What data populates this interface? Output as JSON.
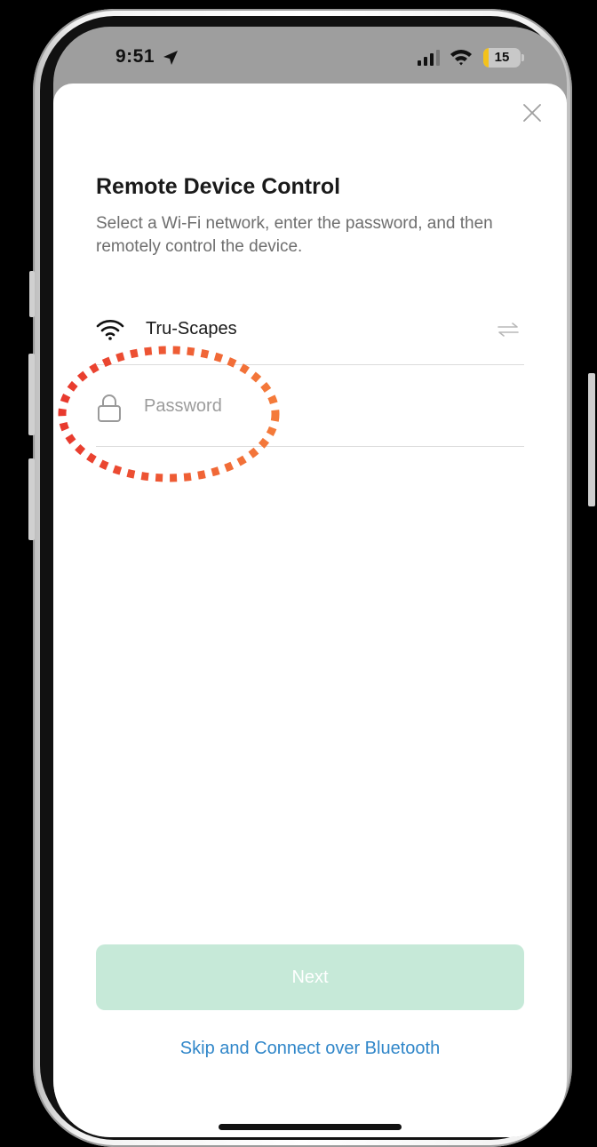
{
  "status_bar": {
    "time": "9:51",
    "battery_level": "15",
    "battery_percent": 15
  },
  "dialog": {
    "title": "Remote Device Control",
    "description": "Select a Wi-Fi network, enter the password, and then remotely control the device.",
    "network_name": "Tru-Scapes",
    "password_placeholder": "Password",
    "next_label": "Next",
    "skip_label": "Skip and Connect over Bluetooth"
  },
  "colors": {
    "accent_link": "#2f86c9",
    "next_button_disabled": "#c6e9d8",
    "annotation_red": "#e8392e",
    "annotation_orange": "#f47b3a",
    "battery_yellow": "#f3c21b"
  }
}
